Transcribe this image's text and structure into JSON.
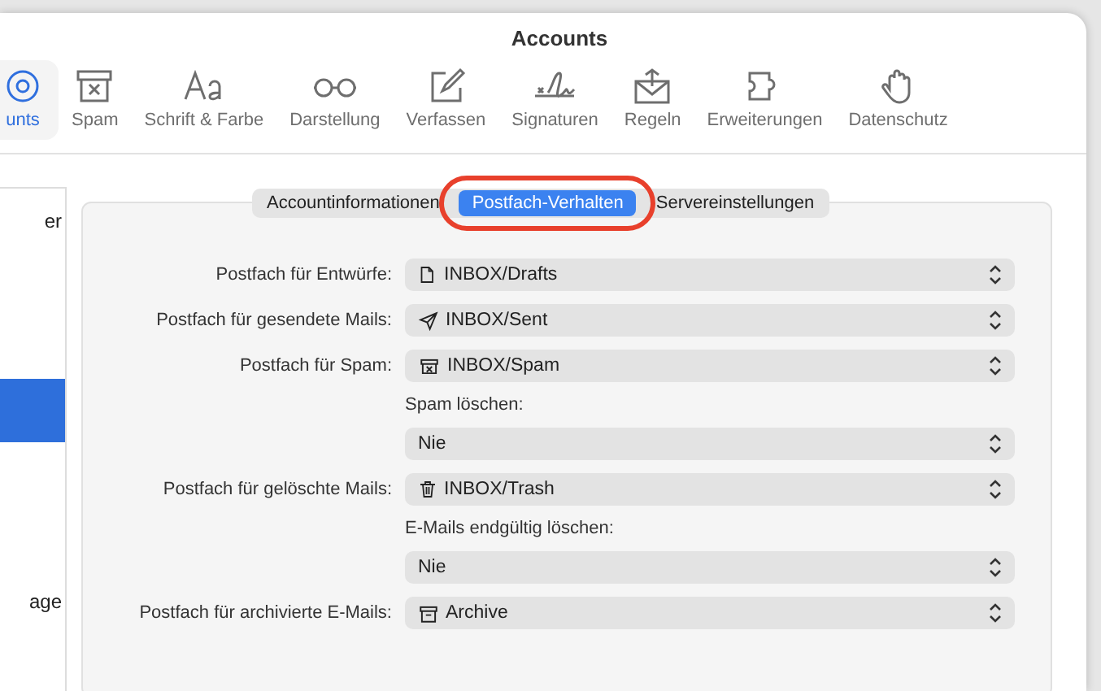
{
  "window": {
    "title": "Accounts"
  },
  "toolbar": [
    {
      "label": "unts",
      "selected": true
    },
    {
      "label": "Spam",
      "selected": false
    },
    {
      "label": "Schrift & Farbe",
      "selected": false
    },
    {
      "label": "Darstellung",
      "selected": false
    },
    {
      "label": "Verfassen",
      "selected": false
    },
    {
      "label": "Signaturen",
      "selected": false
    },
    {
      "label": "Regeln",
      "selected": false
    },
    {
      "label": "Erweiterungen",
      "selected": false
    },
    {
      "label": "Datenschutz",
      "selected": false
    }
  ],
  "sidebar": {
    "items": [
      {
        "label": "er",
        "selected": false
      },
      {
        "selected": true
      },
      {
        "label": "age",
        "selected": false
      }
    ]
  },
  "tabs": [
    {
      "label": "Accountinformationen",
      "selected": false
    },
    {
      "label": "Postfach-Verhalten",
      "selected": true,
      "highlighted": true
    },
    {
      "label": "Servereinstellungen",
      "selected": false
    }
  ],
  "rows": [
    {
      "kind": "popup",
      "label": "Postfach für Entwürfe:",
      "value": "INBOX/Drafts"
    },
    {
      "kind": "popup",
      "label": "Postfach für gesendete Mails:",
      "value": "INBOX/Sent"
    },
    {
      "kind": "popup",
      "label": "Postfach für Spam:",
      "value": "INBOX/Spam"
    },
    {
      "kind": "caption",
      "text": "Spam löschen:"
    },
    {
      "kind": "popup",
      "value": "Nie"
    },
    {
      "kind": "popup",
      "label": "Postfach für gelöschte Mails:",
      "value": "INBOX/Trash"
    },
    {
      "kind": "caption",
      "text": "E-Mails endgültig löschen:"
    },
    {
      "kind": "popup",
      "value": "Nie"
    },
    {
      "kind": "popup",
      "label": "Postfach für archivierte E-Mails:",
      "value": "Archive"
    }
  ]
}
